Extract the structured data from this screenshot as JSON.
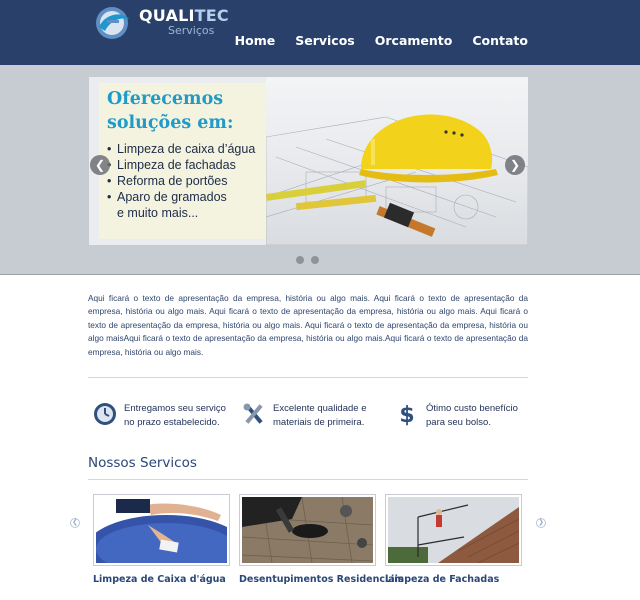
{
  "brand": {
    "name_part1": "QUALI",
    "name_part2": "TEC",
    "subtitle": "Serviços"
  },
  "nav": {
    "items": [
      "Home",
      "Servicos",
      "Orcamento",
      "Contato"
    ]
  },
  "slider": {
    "title_line1": "Oferecemos",
    "title_line2": "soluções em:",
    "items": [
      "Limpeza de caixa d’água",
      "Limpeza de fachadas",
      "Reforma de portões",
      "Aparo de gramados"
    ],
    "more": "e muito mais...",
    "prev_icon": "chevron-left-icon",
    "next_icon": "chevron-right-icon",
    "slide_count": 2
  },
  "intro": {
    "text": "Aqui ficará o texto de apresentação da empresa, história ou algo mais. Aqui ficará o texto de apresentação da empresa, história ou algo mais. Aqui ficará o texto de apresentação da empresa, história ou algo mais. Aqui ficará o texto de apresentação da empresa, história ou algo mais. Aqui ficará o texto de apresentação da empresa, história ou algo maisAqui ficará o texto de apresentação da empresa, história ou algo mais.Aqui ficará o texto de apresentação da empresa, história ou algo mais."
  },
  "features": [
    {
      "icon": "clock-icon",
      "line1": "Entregamos seu serviço",
      "line2": "no prazo estabelecido."
    },
    {
      "icon": "tools-icon",
      "line1": "Excelente qualidade e",
      "line2": "materiais de primeira."
    },
    {
      "icon": "dollar-icon",
      "line1": "Ótimo custo benefício",
      "line2": "para seu bolso."
    }
  ],
  "services": {
    "title": "Nossos Servicos",
    "items": [
      {
        "caption": "Limpeza de Caixa d'água"
      },
      {
        "caption": "Desentupimentos Residenciais"
      },
      {
        "caption": "Limpeza de Fachadas"
      }
    ]
  },
  "colors": {
    "header": "#29416a",
    "accent": "#1f9bc9",
    "text": "#2e446e"
  }
}
